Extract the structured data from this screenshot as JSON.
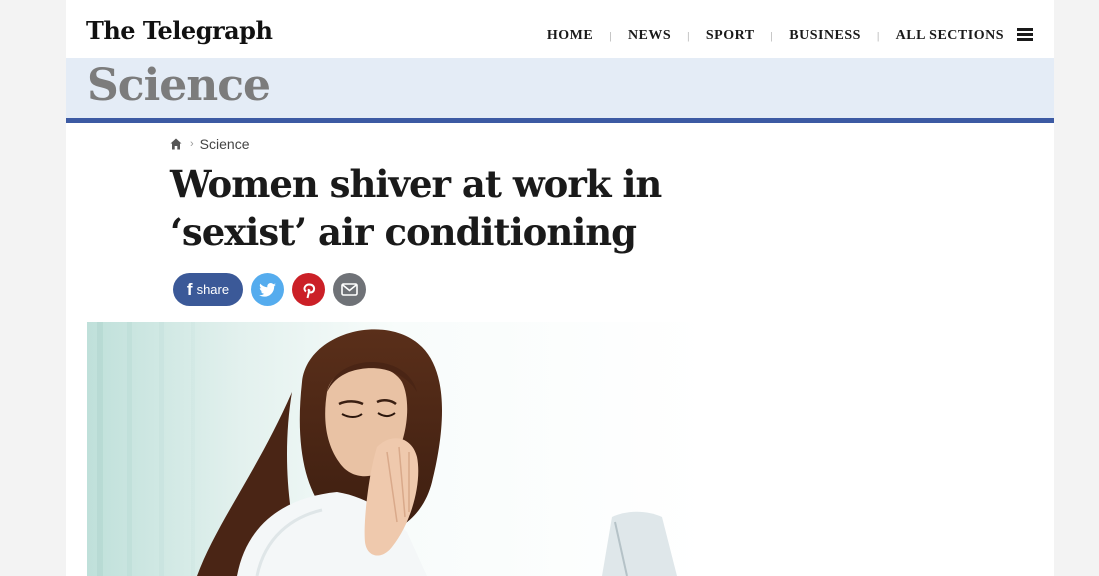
{
  "masthead": {
    "logo_text": "The Telegraph",
    "nav": [
      {
        "label": "HOME"
      },
      {
        "label": "NEWS"
      },
      {
        "label": "SPORT"
      },
      {
        "label": "BUSINESS"
      },
      {
        "label": "ALL SECTIONS"
      }
    ],
    "separator": "|",
    "menu_icon": "hamburger-icon"
  },
  "section": {
    "title": "Science",
    "accent_color": "#3c5aa3",
    "banner_color": "#e4ecf6"
  },
  "breadcrumb": {
    "home_icon": "home-icon",
    "separator": "›",
    "current": "Science"
  },
  "article": {
    "headline": "Women shiver at work in ‘sexist’ air conditioning"
  },
  "share": {
    "facebook_label": "share",
    "facebook_glyph": "f",
    "facebook_color": "#3b5998",
    "twitter_color": "#55acee",
    "pinterest_color": "#cb2027",
    "email_color": "#6f7277",
    "icons": [
      "facebook-icon",
      "twitter-icon",
      "pinterest-icon",
      "email-icon"
    ]
  },
  "hero_image": {
    "icon": "photo-woman-warming-hands"
  }
}
